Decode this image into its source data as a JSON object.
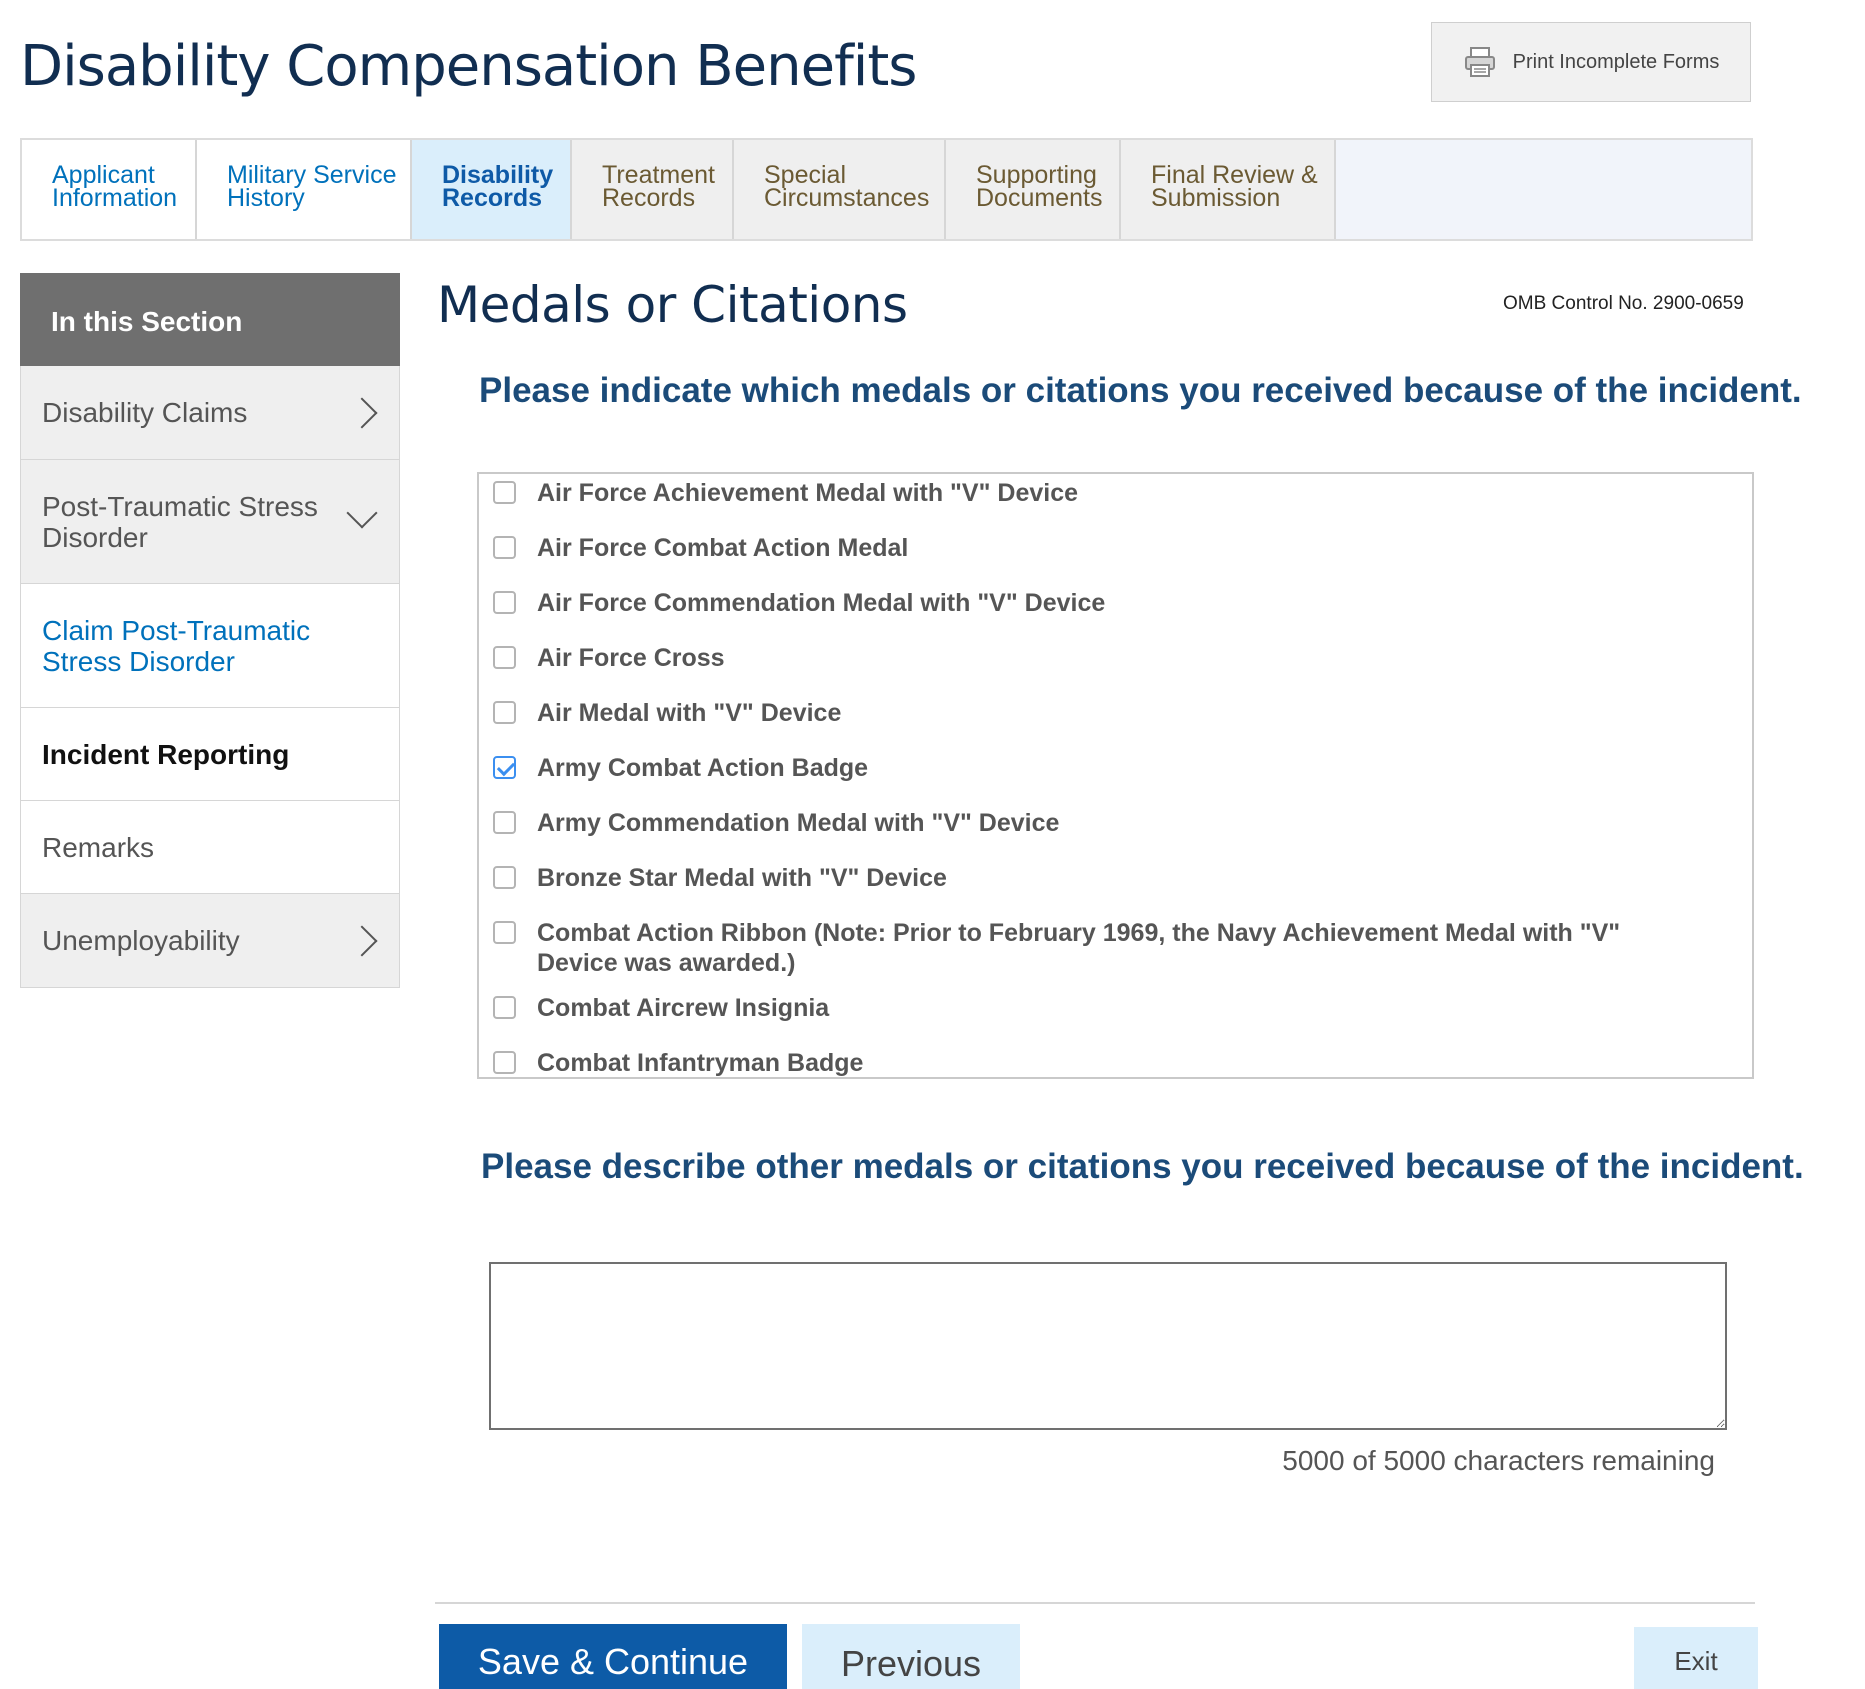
{
  "header": {
    "title": "Disability Compensation Benefits",
    "print_label": "Print Incomplete Forms"
  },
  "steps": [
    {
      "label_line1": "Applicant",
      "label_line2": "Information",
      "state": "done"
    },
    {
      "label_line1": "Military Service",
      "label_line2": "History",
      "state": "done"
    },
    {
      "label_line1": "Disability",
      "label_line2": "Records",
      "state": "active"
    },
    {
      "label_line1": "Treatment",
      "label_line2": "Records",
      "state": "pending"
    },
    {
      "label_line1": "Special",
      "label_line2": "Circumstances",
      "state": "pending"
    },
    {
      "label_line1": "Supporting",
      "label_line2": "Documents",
      "state": "pending"
    },
    {
      "label_line1": "Final Review &",
      "label_line2": "Submission",
      "state": "pending"
    }
  ],
  "sidebar": {
    "heading": "In this Section",
    "items": [
      {
        "label": "Disability Claims"
      },
      {
        "label": "Post-Traumatic Stress Disorder"
      },
      {
        "label": "Claim Post-Traumatic Stress Disorder"
      },
      {
        "label": "Incident Reporting"
      },
      {
        "label": "Remarks"
      },
      {
        "label": "Unemployability"
      }
    ]
  },
  "main": {
    "title": "Medals or Citations",
    "omb": "OMB Control No. 2900-0659",
    "question1": "Please indicate which medals or citations you received because of the incident.",
    "medals": [
      {
        "label": "Air Force Achievement Medal with \"V\" Device",
        "checked": false
      },
      {
        "label": "Air Force Combat Action Medal",
        "checked": false
      },
      {
        "label": "Air Force Commendation Medal with \"V\" Device",
        "checked": false
      },
      {
        "label": "Air Force Cross",
        "checked": false
      },
      {
        "label": "Air Medal with \"V\" Device",
        "checked": false
      },
      {
        "label": "Army Combat Action Badge",
        "checked": true
      },
      {
        "label": "Army Commendation Medal with \"V\" Device",
        "checked": false
      },
      {
        "label": "Bronze Star Medal with \"V\" Device",
        "checked": false
      },
      {
        "label": "Combat Action Ribbon (Note: Prior to February 1969, the Navy Achievement Medal with \"V\" Device was awarded.)",
        "checked": false
      },
      {
        "label": "Combat Aircrew Insignia",
        "checked": false
      },
      {
        "label": "Combat Infantryman Badge",
        "checked": false
      }
    ],
    "question2": "Please describe other medals or citations you received because of the incident.",
    "description_value": "",
    "remaining": "5000 of 5000 characters remaining"
  },
  "footer": {
    "save_label": "Save & Continue",
    "previous_label": "Previous",
    "exit_label": "Exit"
  },
  "colors": {
    "brand_navy": "#112e51",
    "primary_button": "#0d5ba7",
    "link_blue": "#0071bb",
    "active_tab": "#daeefb",
    "checkbox_checked": "#3b8ff0"
  }
}
